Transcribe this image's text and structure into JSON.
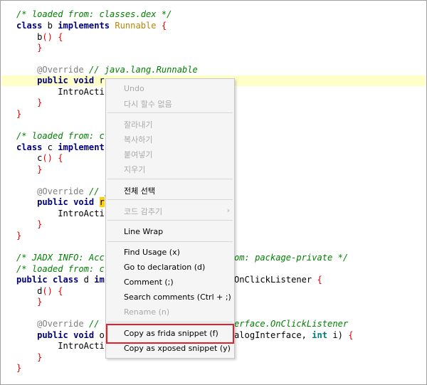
{
  "code": {
    "l1": "/* loaded from: classes.dex */",
    "l2_kw1": "class",
    "l2_name": " b ",
    "l2_kw2": "implements",
    "l2_iface": "Runnable",
    "l2_br": "{",
    "l3_name": "b",
    "l3_br": "() {",
    "l4_br": "}",
    "l6_ann": "@Override",
    "l6_cm": "// java.lang.Runnable",
    "l7_kw": "public void",
    "l7_sel": "r",
    "l8_text": "IntroActi",
    "l9_br": "}",
    "l10_br": "}",
    "l12_cm": "/* loaded from: c",
    "l13_kw1": "class",
    "l13_name": " c ",
    "l13_kw2": "implement",
    "l14_name": "c",
    "l14_br": "() {",
    "l15_br": "}",
    "l17_ann": "@Override",
    "l17_cm": "// j",
    "l18_kw": "public void",
    "l18_sel": "r",
    "l19_text": "IntroActi",
    "l20_br": "}",
    "l21_br": "}",
    "l23_cm_a": "/* JADX INFO: Acc",
    "l23_cm_b": "om: package-private */",
    "l24_cm": "/* loaded from: c",
    "l25_kw": "public class",
    "l25_name": " d ",
    "l25_kw2": "im",
    "l25_rest": "OnClickListener",
    "l25_br": "{",
    "l26_name": "d",
    "l26_br": "() {",
    "l27_br": "}",
    "l29_ann": "@Override",
    "l29_cm_a": "//",
    "l29_cm_b": "erface.OnClickListener",
    "l30_kw": "public void",
    "l30_o": "o",
    "l30_rest_a": "alogInterface,",
    "l30_int": "int",
    "l30_rest_b": "i)",
    "l30_br": "{",
    "l31_text": "IntroActi",
    "l32_br": "}",
    "l33_br": "}"
  },
  "context_menu": {
    "undo": "Undo",
    "redo": "다시 할수 없음",
    "cut": "잘라내기",
    "copy": "복사하기",
    "paste": "붙여넣기",
    "delete": "지우기",
    "select_all": "전체 선택",
    "code_folding": "코드 감추기",
    "line_wrap": "Line Wrap",
    "find_usage": "Find Usage (x)",
    "goto_declaration": "Go to declaration (d)",
    "comment": "Comment (;)",
    "search_comments": "Search comments (Ctrl + ;)",
    "rename": "Rename (n)",
    "copy_frida": "Copy as frida snippet (f)",
    "copy_xposed": "Copy as xposed snippet (y)"
  },
  "icons": {
    "submenu": "chevron-right-icon"
  },
  "colors": {
    "highlight_box": "#e0202a",
    "line_highlight": "#ffffc8",
    "selection": "#ffd000"
  }
}
